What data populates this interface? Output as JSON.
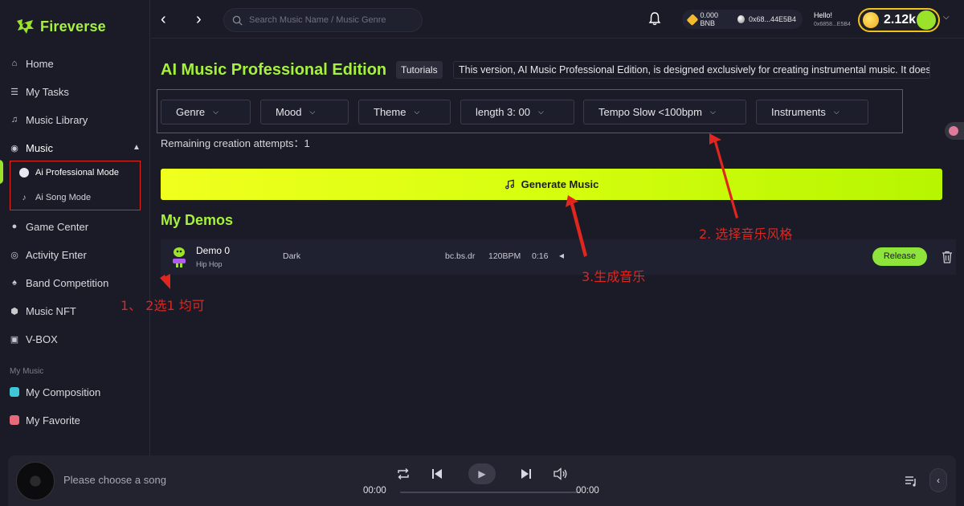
{
  "app": {
    "brand": "Fireverse"
  },
  "sidebar": {
    "items": [
      {
        "label": "Home",
        "icon": "home-icon"
      },
      {
        "label": "My Tasks",
        "icon": "tasks-icon"
      },
      {
        "label": "Music Library",
        "icon": "music-note-icon"
      },
      {
        "label": "Music",
        "icon": "music-disc-icon"
      },
      {
        "label": "Game Center",
        "icon": "gamepad-icon"
      },
      {
        "label": "Activity Enter",
        "icon": "globe-icon"
      },
      {
        "label": "Band Competition",
        "icon": "trophy-icon"
      },
      {
        "label": "Music NFT",
        "icon": "cube-icon"
      },
      {
        "label": "V-BOX",
        "icon": "box-icon"
      }
    ],
    "music_sub": [
      {
        "label": "Ai Professional Mode"
      },
      {
        "label": "Ai Song Mode"
      }
    ],
    "section_label": "My Music",
    "my_music": [
      {
        "label": "My Composition",
        "color": "#3fc7d8"
      },
      {
        "label": "My Favorite",
        "color": "#e86a7a"
      }
    ]
  },
  "topbar": {
    "search_placeholder": "Search Music Name / Music Genre",
    "bnb_balance": "0.000 BNB",
    "wallet_address": "0x68...44E5B4",
    "greeting": "Hello!",
    "user_address": "0x6858...E5B4",
    "coins": "2.12k"
  },
  "main": {
    "title": "AI Music Professional Edition",
    "tutorials": "Tutorials",
    "description": "This version, AI Music Professional Edition, is designed exclusively for creating instrumental music. It does",
    "filters": [
      "Genre",
      "Mood",
      "Theme",
      "length 3: 00",
      "Tempo Slow <100bpm",
      "Instruments"
    ],
    "remaining": "Remaining creation attempts：1",
    "generate_label": "Generate Music",
    "demos_title": "My Demos",
    "demos": [
      {
        "name": "Demo 0",
        "genre": "Hip Hop",
        "mood": "Dark",
        "tag": "bc.bs.dr",
        "bpm": "120BPM",
        "duration": "0:16",
        "release_label": "Release"
      }
    ]
  },
  "annotations": {
    "a1": "1、 2选1 均可",
    "a2": "2. 选择音乐风格",
    "a3": "3.生成音乐"
  },
  "player": {
    "placeholder": "Please choose a song",
    "current_time": "00:00",
    "total_time": "00:00"
  },
  "colors": {
    "accent": "#a6f23a",
    "annotation": "#e0261f",
    "background": "#1a1b27"
  }
}
